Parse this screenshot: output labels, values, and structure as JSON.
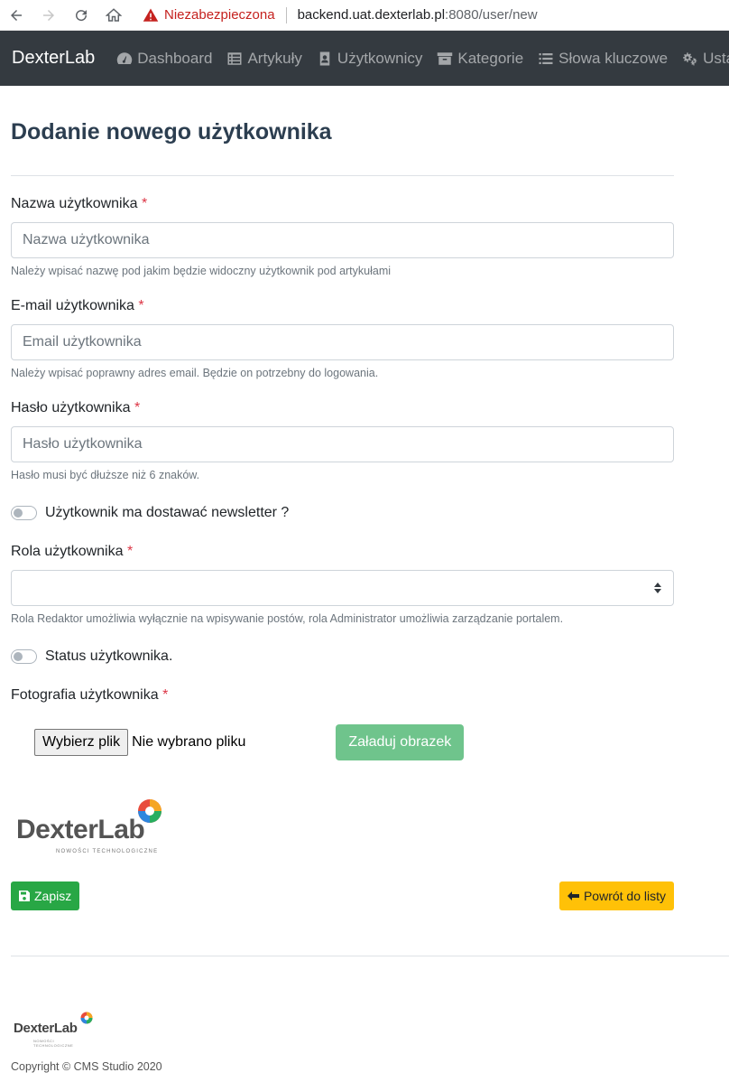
{
  "browser": {
    "insecure_label": "Niezabezpieczona",
    "url_host": "backend.uat.dexterlab.pl",
    "url_path": ":8080/user/new"
  },
  "navbar": {
    "brand": "DexterLab",
    "items": [
      {
        "label": "Dashboard",
        "icon": "dashboard-icon"
      },
      {
        "label": "Artykuły",
        "icon": "list-alt-icon"
      },
      {
        "label": "Użytkownicy",
        "icon": "address-book-icon"
      },
      {
        "label": "Kategorie",
        "icon": "archive-icon"
      },
      {
        "label": "Słowa kluczowe",
        "icon": "list-icon"
      },
      {
        "label": "Ustaw",
        "icon": "cogs-icon"
      }
    ]
  },
  "page": {
    "title": "Dodanie nowego użytkownika"
  },
  "form": {
    "required_mark": "*",
    "username": {
      "label": "Nazwa użytkownika",
      "placeholder": "Nazwa użytkownika",
      "value": "",
      "help": "Należy wpisać nazwę pod jakim będzie widoczny użytkownik pod artykułami"
    },
    "email": {
      "label": "E-mail użytkownika",
      "placeholder": "Email użytkownika",
      "value": "",
      "help": "Należy wpisać poprawny adres email. Będzie on potrzebny do logowania."
    },
    "password": {
      "label": "Hasło użytkownika",
      "placeholder": "Hasło użytkownika",
      "value": "",
      "help": "Hasło musi być dłuższe niż 6 znaków."
    },
    "newsletter": {
      "label": "Użytkownik ma dostawać newsletter ?",
      "checked": false
    },
    "role": {
      "label": "Rola użytkownika",
      "selected": "",
      "help": "Rola Redaktor umożliwia wyłącznie na wpisywanie postów, rola Administrator umożliwia zarządzanie portalem."
    },
    "status": {
      "label": "Status użytkownika.",
      "checked": false
    },
    "photo": {
      "label": "Fotografia użytkownika",
      "file_button": "Wybierz plik",
      "file_status": "Nie wybrano pliku",
      "upload_button": "Załaduj obrazek"
    },
    "logo": {
      "text": "DexterLab",
      "subtitle": "NOWOŚCI TECHNOLOGICZNE"
    },
    "save_button": "Zapisz",
    "back_button": "Powrót do listy"
  },
  "footer": {
    "logo_text": "DexterLab",
    "logo_subtitle": "NOWOŚCI TECHNOLOGICZNE",
    "copyright": "Copyright © CMS Studio 2020"
  },
  "colors": {
    "navbar_bg": "#343a40",
    "save_green": "#28a745",
    "upload_green": "#6fc48c",
    "back_yellow": "#ffc107",
    "required_red": "#dc3545",
    "insecure_red": "#c5221f"
  }
}
